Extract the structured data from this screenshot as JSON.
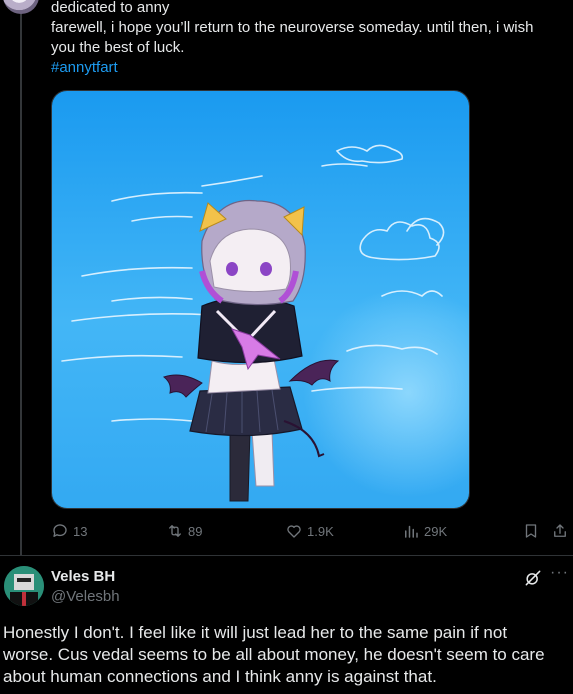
{
  "post": {
    "line1": "dedicated to anny",
    "line2": "farewell, i hope you’ll return to the neuroverse someday. until then, i wish",
    "line3": "you the best of luck.",
    "hashtag": "#annytfart",
    "image_alt": "drawing of a purple-haired girl with cat ears and small devil wings in a sailor uniform against a blue sky",
    "actions": {
      "replies": "13",
      "reposts": "89",
      "likes": "1.9K",
      "views": "29K"
    }
  },
  "reply": {
    "name": "Veles BH",
    "handle": "@Velesbh",
    "text_line1": "Honestly I don't. I feel like it will just lead her to the same pain if not",
    "text_line2": "worse. Cus vedal seems to be all about money, he doesn't seem to care",
    "text_line3": "about human connections and I think anny is against that."
  },
  "colors": {
    "background": "#000000",
    "text": "#e7e9ea",
    "muted": "#71767b",
    "link": "#1d9bf0",
    "divider": "#2f3336"
  }
}
